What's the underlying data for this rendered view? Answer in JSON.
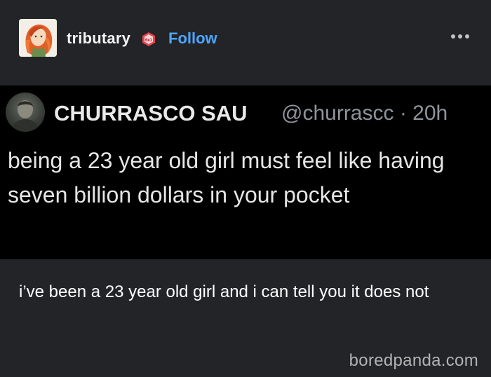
{
  "post": {
    "username": "tributary",
    "follow_label": "Follow",
    "more_icon": "ellipsis-icon",
    "avatar_icon": "redhead-avatar"
  },
  "tweet": {
    "display_name": "CHURRASCO SAU",
    "handle_time": "@churrascc · 20h",
    "text": "being a 23 year old girl must feel like having seven billion dollars in your pocket"
  },
  "caption": "i’ve been a 23 year old girl and i can tell you it does not",
  "watermark": "boredpanda.com",
  "colors": {
    "background": "#222427",
    "tweet_background": "#000000",
    "follow_blue": "#4ea6ff"
  }
}
